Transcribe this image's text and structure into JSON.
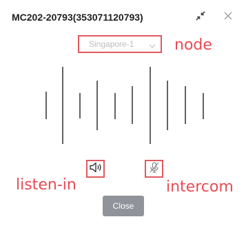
{
  "dialog": {
    "title": "MC202-20793(353071120793)",
    "node_select": {
      "value": "Singapore-1"
    },
    "close_button_label": "Close"
  },
  "annotations": {
    "node": "node",
    "listen_in": "listen-in",
    "intercom": "intercom"
  },
  "icons": {
    "collapse": "collapse-icon",
    "close": "close-icon",
    "chevron": "chevron-down-icon",
    "speaker": "speaker-icon",
    "microphone_muted": "microphone-muted-icon"
  },
  "colors": {
    "annotation_red": "#e84c54",
    "close_button": "#909399",
    "wave_bar": "#606266"
  }
}
